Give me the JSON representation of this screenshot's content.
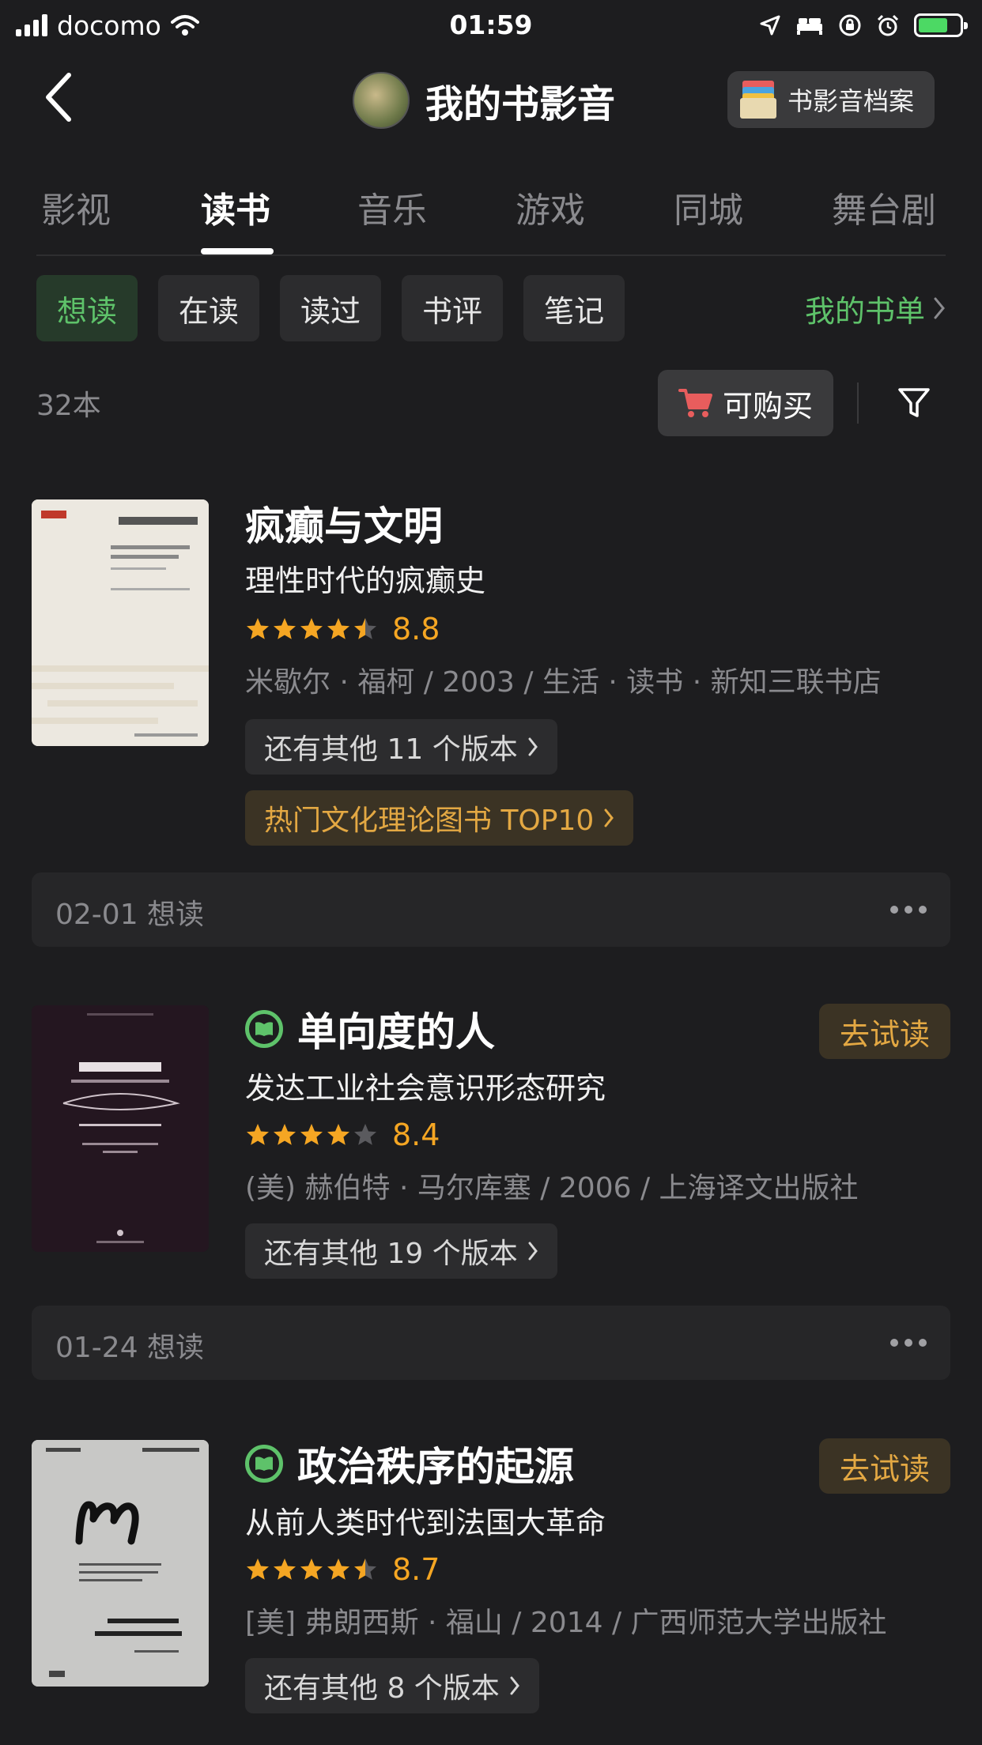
{
  "status_bar": {
    "carrier": "docomo",
    "time": "01:59"
  },
  "nav": {
    "title": "我的书影音",
    "archive_label": "书影音档案"
  },
  "tabs": [
    "影视",
    "读书",
    "音乐",
    "游戏",
    "同城",
    "舞台剧"
  ],
  "active_tab": "读书",
  "chips": [
    "想读",
    "在读",
    "读过",
    "书评",
    "笔记"
  ],
  "active_chip": "想读",
  "booklist_link": "我的书单",
  "count_label": "32本",
  "buy_label": "可购买",
  "colors": {
    "accent_green": "#5ec26a",
    "star_orange": "#f5a623",
    "gold_text": "#e3a843"
  },
  "books": [
    {
      "title": "疯癫与文明",
      "subtitle": "理性时代的疯癫史",
      "rating": 4.5,
      "score": "8.8",
      "meta": "米歇尔 · 福柯 / 2003 / 生活 · 读书 · 新知三联书店",
      "versions": "还有其他 11 个版本",
      "rank": "热门文化理论图书 TOP10",
      "mark": "02-01 想读",
      "ebook": false,
      "trial_label": ""
    },
    {
      "title": "单向度的人",
      "subtitle": "发达工业社会意识形态研究",
      "rating": 4,
      "score": "8.4",
      "meta": "(美) 赫伯特 · 马尔库塞 / 2006 / 上海译文出版社",
      "versions": "还有其他 19 个版本",
      "rank": "",
      "mark": "01-24 想读",
      "ebook": true,
      "trial_label": "去试读"
    },
    {
      "title": "政治秩序的起源",
      "subtitle": "从前人类时代到法国大革命",
      "rating": 4.5,
      "score": "8.7",
      "meta": "[美] 弗朗西斯 · 福山 / 2014 / 广西师范大学出版社",
      "versions": "还有其他 8 个版本",
      "rank": "",
      "mark": "",
      "ebook": true,
      "trial_label": "去试读"
    }
  ]
}
